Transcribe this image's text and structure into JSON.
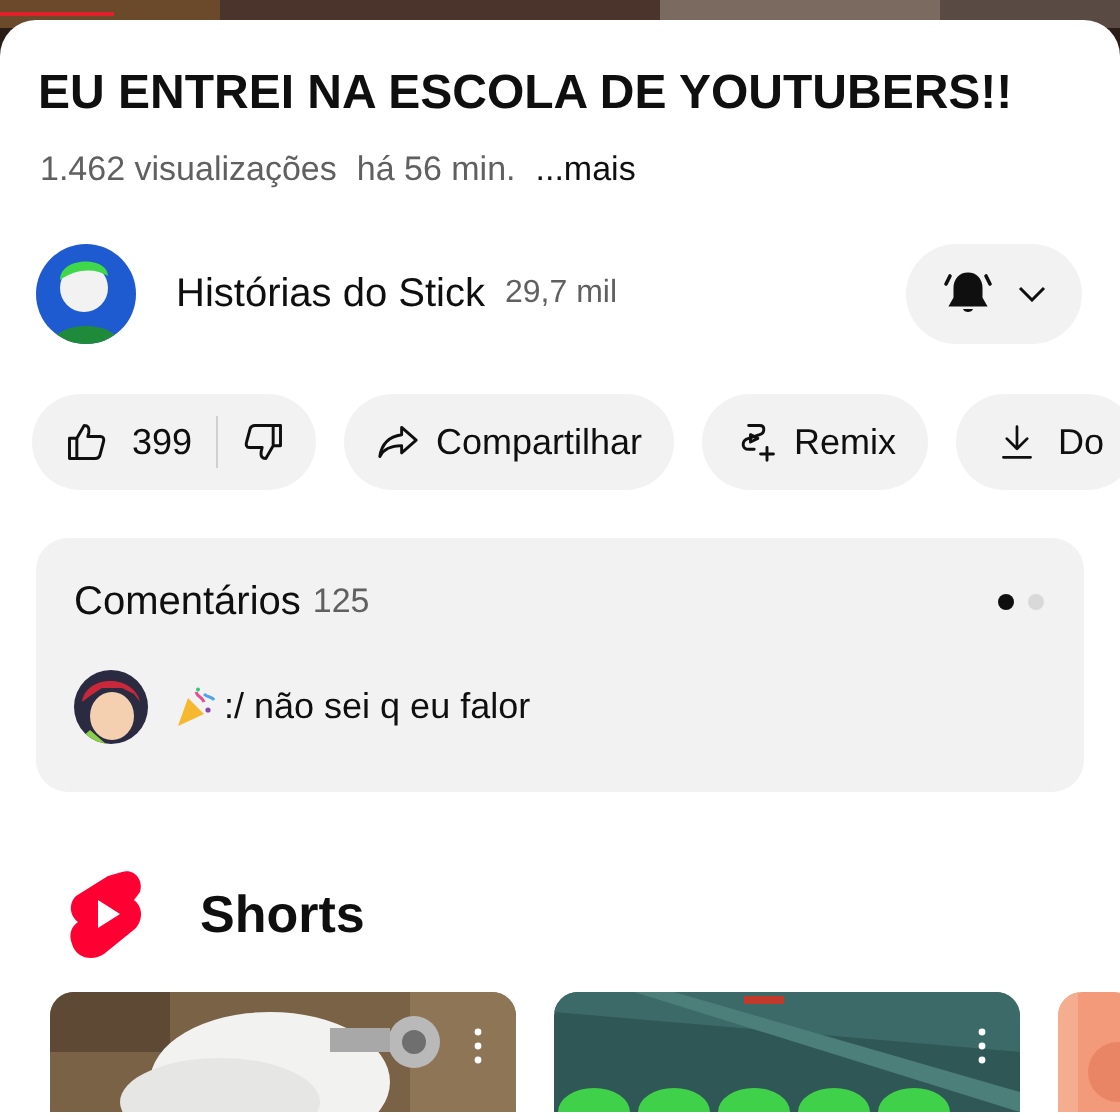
{
  "video": {
    "title": "EU ENTREI NA ESCOLA DE YOUTUBERS!!",
    "views": "1.462 visualizações",
    "age": "há 56 min.",
    "more": "...mais"
  },
  "channel": {
    "name": "Histórias do Stick",
    "subscribers": "29,7 mil",
    "notifications": true
  },
  "actions": [
    {
      "kind": "like",
      "label": "399"
    },
    {
      "kind": "share",
      "label": "Compartilhar"
    },
    {
      "kind": "remix",
      "label": "Remix"
    },
    {
      "kind": "download",
      "label": "Do"
    }
  ],
  "comments": {
    "title": "Comentários",
    "count": "125",
    "pages": [
      {
        "selected": true
      },
      {
        "selected": false
      }
    ],
    "top_comment": ":/ não sei q eu falor"
  },
  "shorts": {
    "title": "Shorts"
  }
}
